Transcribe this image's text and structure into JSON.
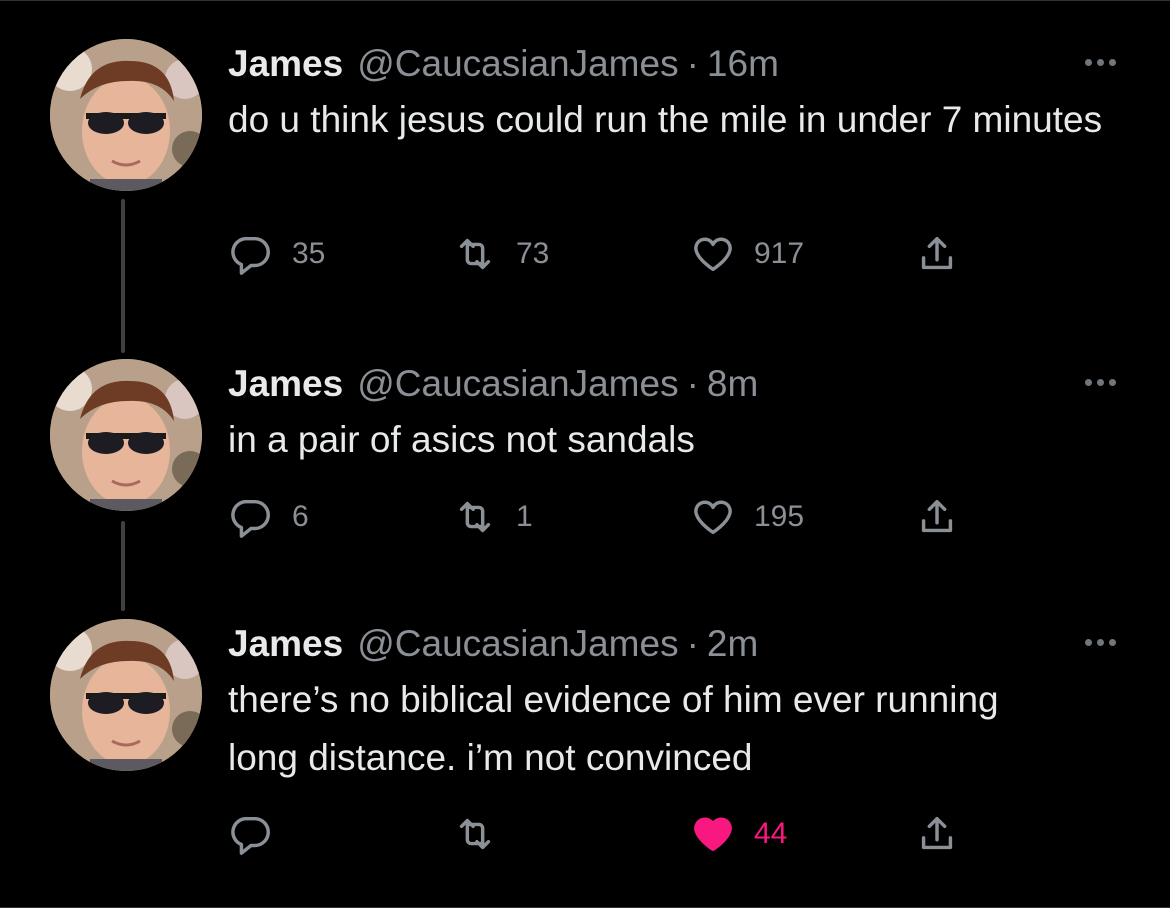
{
  "thread": [
    {
      "name": "James",
      "handle": "@CaucasianJames",
      "separator": "·",
      "time": "16m",
      "text": "do u think jesus could run the mile in under 7 minutes",
      "replies": "35",
      "retweets": "73",
      "likes": "917",
      "liked": false
    },
    {
      "name": "James",
      "handle": "@CaucasianJames",
      "separator": "·",
      "time": "8m",
      "text": "in a pair of asics not sandals",
      "replies": "6",
      "retweets": "1",
      "likes": "195",
      "liked": false
    },
    {
      "name": "James",
      "handle": "@CaucasianJames",
      "separator": "·",
      "time": "2m",
      "text": "there’s no biblical evidence of him ever running long distance. i’m not convinced",
      "replies": "",
      "retweets": "",
      "likes": "44",
      "liked": true
    }
  ],
  "icons": {
    "reply": "reply-icon",
    "retweet": "retweet-icon",
    "like": "heart-icon",
    "share": "share-icon",
    "more": "more-icon"
  },
  "colors": {
    "background": "#000000",
    "text": "#e7e9ea",
    "secondary": "#8b9096",
    "like": "#f91880"
  }
}
